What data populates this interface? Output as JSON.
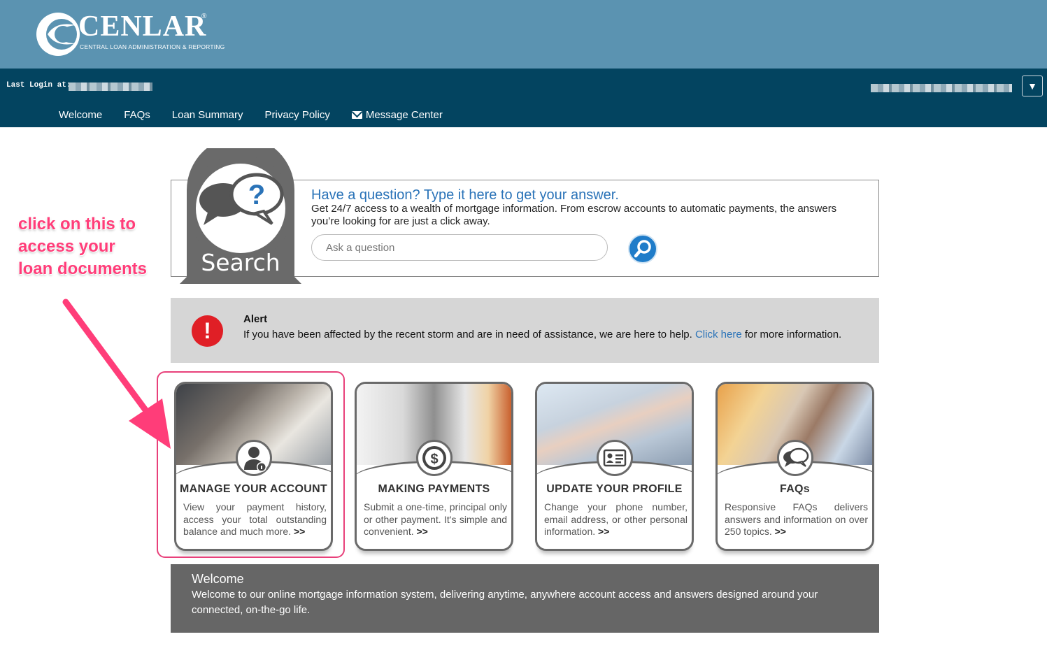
{
  "brand": {
    "name": "CENLAR",
    "registered": "®",
    "tagline": "CENTRAL LOAN ADMINISTRATION & REPORTING",
    "color": "#5b93b1"
  },
  "nav": {
    "last_login_label": "Last Login at:",
    "menu_toggle": "▼",
    "links": [
      "Welcome",
      "FAQs",
      "Loan Summary",
      "Privacy Policy",
      "Message Center"
    ],
    "color": "#034460"
  },
  "search": {
    "badge_label": "Search",
    "title": "Have a question? Type it here to get your answer.",
    "description": "Get 24/7 access to a wealth of mortgage information. From escrow accounts to automatic payments, the answers you’re looking for are just a click away.",
    "placeholder": "Ask a question",
    "button_icon": "search-icon"
  },
  "alert": {
    "title": "Alert",
    "text_before": "If you have been affected by the recent storm and are in need of assistance, we are here to help. ",
    "link": "Click here",
    "text_after": " for more information.",
    "icon": "exclamation-icon",
    "color": "#e01f26"
  },
  "cards": [
    {
      "title": "MANAGE YOUR ACCOUNT",
      "body": "View your payment history, access your total outstanding balance and much more.",
      "arrow": ">>",
      "icon": "user-info-icon"
    },
    {
      "title": "MAKING PAYMENTS",
      "body": "Submit a one-time, principal only or other payment. It's simple and convenient.",
      "arrow": ">>",
      "icon": "dollar-icon"
    },
    {
      "title": "UPDATE YOUR PROFILE",
      "body": "Change your phone number, email address, or other personal information.",
      "arrow": ">>",
      "icon": "id-card-icon"
    },
    {
      "title": "FAQs",
      "body": "Responsive FAQs delivers answers and information on over 250 topics.",
      "arrow": ">>",
      "icon": "chat-bubbles-icon"
    }
  ],
  "annotation": {
    "text": "click on this to access your loan documents",
    "color": "#ff3d79"
  },
  "welcome": {
    "title": "Welcome",
    "text": "Welcome to our online mortgage information system, delivering anytime, anywhere account access and answers designed around your connected, on-the-go life."
  }
}
